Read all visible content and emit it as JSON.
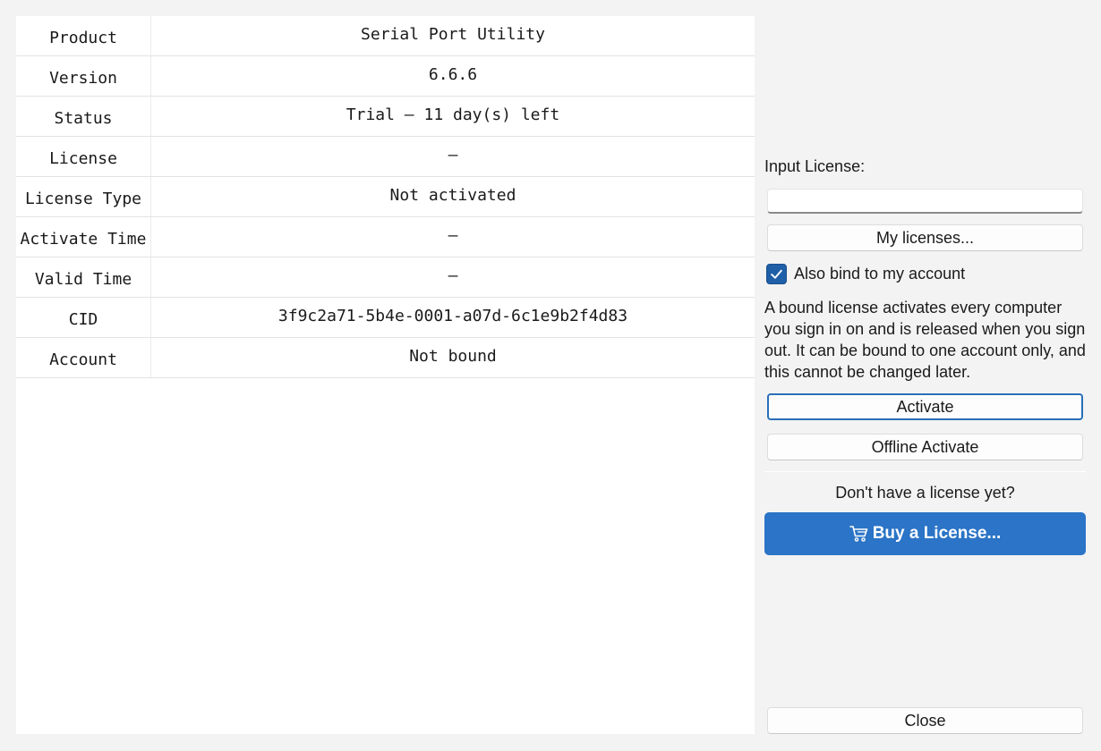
{
  "info_table": {
    "rows": [
      {
        "key": "Product",
        "value": "Serial Port Utility"
      },
      {
        "key": "Version",
        "value": "6.6.6"
      },
      {
        "key": "Status",
        "value": "Trial — 11 day(s) left"
      },
      {
        "key": "License",
        "value": "—"
      },
      {
        "key": "License Type",
        "value": "Not activated"
      },
      {
        "key": "Activate Time",
        "value": "—"
      },
      {
        "key": "Valid Time",
        "value": "—"
      },
      {
        "key": "CID",
        "value": "3f9c2a71-5b4e-0001-a07d-6c1e9b2f4d83"
      },
      {
        "key": "Account",
        "value": "Not bound"
      }
    ]
  },
  "activation": {
    "input_label": "Input License:",
    "input_value": "",
    "input_placeholder": "",
    "my_licenses_label": "My licenses...",
    "bind_checkbox_label": "Also bind to my account",
    "bind_checked": true,
    "description": "A bound license activates every computer you sign in on and is released when you sign out. It can be bound to one account only, and this cannot be changed later.",
    "activate_label": "Activate",
    "offline_activate_label": "Offline Activate",
    "no_license_prompt": "Don't have a license yet?",
    "buy_label": "Buy a License...",
    "close_label": "Close"
  },
  "icons": {
    "checkbox": "checkmark-icon",
    "buy": "shopping-cart-icon"
  },
  "colors": {
    "accent": "#2b74c7",
    "checkbox": "#1f5fa8",
    "focus_border": "#2a6fb8",
    "background": "#f3f3f3"
  }
}
